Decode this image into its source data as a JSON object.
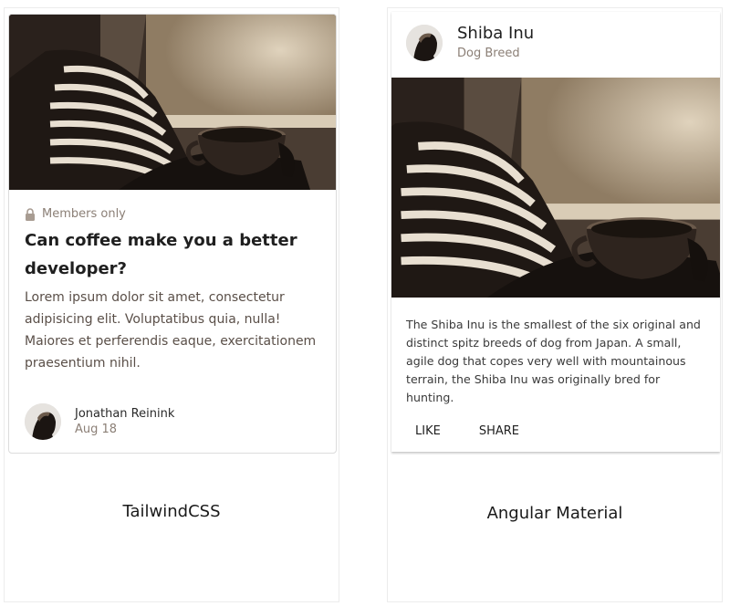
{
  "tailwind": {
    "meta_label": "Members only",
    "title": "Can coffee make you a better developer?",
    "body": "Lorem ipsum dolor sit amet, consectetur adipisicing elit. Voluptatibus quia, nulla! Maiores et perferendis eaque, exercitationem praesentium nihil.",
    "author_name": "Jonathan Reinink",
    "author_date": "Aug 18",
    "caption": "TailwindCSS"
  },
  "material": {
    "title": "Shiba Inu",
    "subtitle": "Dog Breed",
    "body": "The Shiba Inu is the smallest of the six original and distinct spitz breeds of dog from Japan. A small, agile dog that copes very well with mountainous terrain, the Shiba Inu was originally bred for hunting.",
    "actions": [
      "LIKE",
      "SHARE"
    ],
    "caption": "Angular Material"
  },
  "icons": {
    "meta": "lock-icon"
  },
  "colors": {
    "muted": "#8b7f76",
    "photo_sepia": "#b8a082"
  }
}
